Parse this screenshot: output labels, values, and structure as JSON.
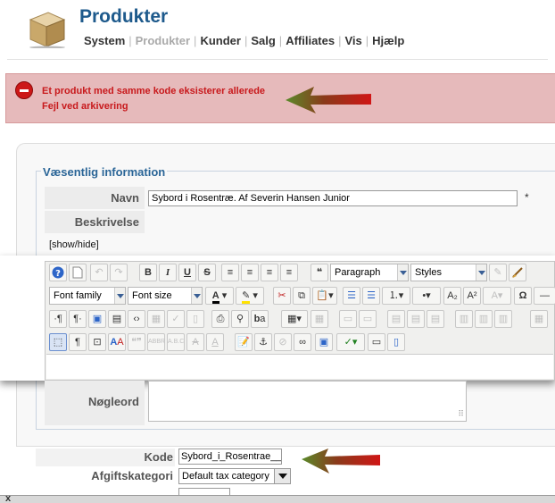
{
  "header": {
    "title": "Produkter",
    "menu": [
      {
        "label": "System",
        "disabled": false
      },
      {
        "label": "Produkter",
        "disabled": true
      },
      {
        "label": "Kunder",
        "disabled": false
      },
      {
        "label": "Salg",
        "disabled": false
      },
      {
        "label": "Affiliates",
        "disabled": false
      },
      {
        "label": "Vis",
        "disabled": false
      },
      {
        "label": "Hjælp",
        "disabled": false
      }
    ]
  },
  "error": {
    "line1": "Et produkt med samme kode eksisterer allerede",
    "line2": "Fejl ved arkivering"
  },
  "form": {
    "legend": "Væsentlig information",
    "navn_label": "Navn",
    "navn_value": "Sybord i Rosentræ. Af Severin Hansen Junior",
    "required_mark": "*",
    "beskrivelse_label": "Beskrivelse",
    "showhide": "[show/hide]",
    "noegleord_label": "Nøgleord",
    "kode_label": "Kode",
    "kode_value": "Sybord_i_Rosentrae__A",
    "afgift_label": "Afgiftskategori",
    "afgift_value": "Default tax category"
  },
  "editor": {
    "format_select": "Paragraph",
    "styles_select": "Styles",
    "font_family": "Font family",
    "font_size": "Font size"
  },
  "colors": {
    "title": "#1e5a8c",
    "error_bg": "#e6babb",
    "error_text": "#c8191c",
    "arrow": "#c41a1a"
  }
}
